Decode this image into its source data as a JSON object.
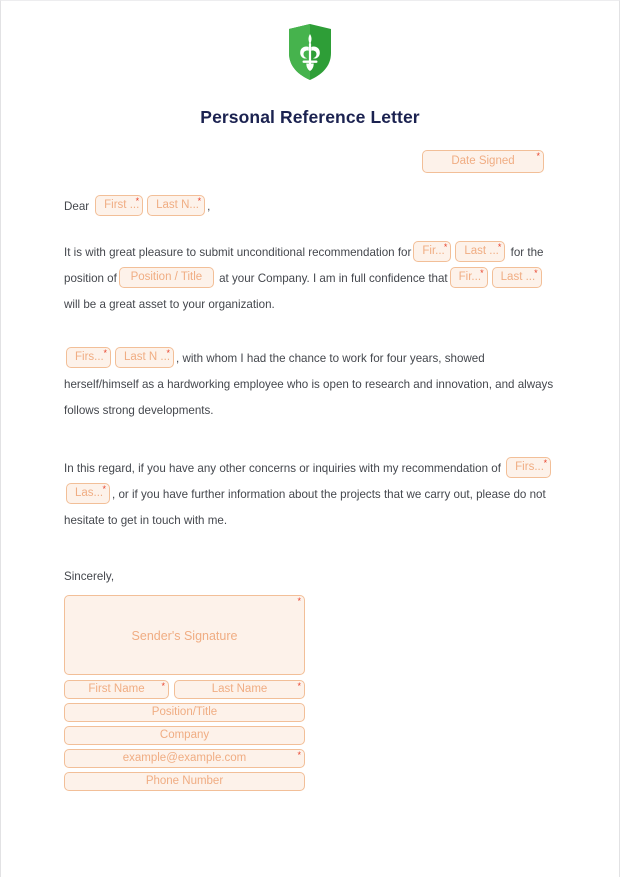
{
  "document": {
    "title": "Personal Reference Letter",
    "logo_icon": "green-shield-fleur-de-lis-logo",
    "title_color": "#1b2250",
    "field_border_color": "#f2bf98",
    "field_background_color": "#fdf2ea",
    "placeholder_color": "#f0ad83",
    "required_marker": "*",
    "required_marker_color": "#e8442e"
  },
  "date_field": {
    "placeholder": "Date Signed",
    "required": "*"
  },
  "salutation": {
    "lead": "Dear",
    "first_name_placeholder": "First ...",
    "last_name_placeholder": "Last N...",
    "trailing": ","
  },
  "paragraph_1": {
    "segment_1": "It is with great pleasure to submit unconditional recommendation for",
    "first_name_placeholder": "Fir...",
    "last_name_placeholder": "Last ...",
    "segment_2": "for the position of",
    "position_placeholder": "Position / Title",
    "segment_3": "at your Company. I am in full confidence that",
    "first_name_placeholder_2": "Fir...",
    "last_name_placeholder_2": "Last ...",
    "segment_4": "will be a great asset to your organization."
  },
  "paragraph_2": {
    "first_name_placeholder": "Firs...",
    "last_name_placeholder": "Last N ...",
    "segment_1": ", with whom I had the chance to work for four years, showed herself/himself as a hardworking employee who is open to research and innovation, and always follows strong developments."
  },
  "paragraph_3": {
    "segment_1": "In this regard, if you have any other concerns or inquiries with my recommendation of",
    "first_name_placeholder": "Firs...",
    "last_name_placeholder": "Las...",
    "segment_2": ", or if you have further information about the projects that we carry out, please do not hesitate to get in touch with me."
  },
  "closing": {
    "sincerely": "Sincerely,",
    "signature_placeholder": "Sender's Signature",
    "signature_required": "*"
  },
  "contact_fields": {
    "first_name": {
      "placeholder": "First Name",
      "required": "*"
    },
    "last_name": {
      "placeholder": "Last Name",
      "required": "*"
    },
    "position": {
      "placeholder": "Position/Title"
    },
    "company": {
      "placeholder": "Company"
    },
    "email": {
      "placeholder": "example@example.com",
      "required": "*"
    },
    "phone": {
      "placeholder": "Phone Number"
    }
  }
}
